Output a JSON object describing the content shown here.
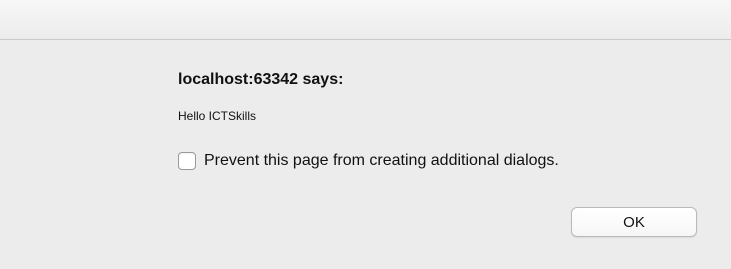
{
  "dialog": {
    "title": "localhost:63342 says:",
    "message": "Hello ICTSkills",
    "checkbox_label": "Prevent this page from creating additional dialogs.",
    "checkbox_checked": false,
    "ok_label": "OK"
  }
}
